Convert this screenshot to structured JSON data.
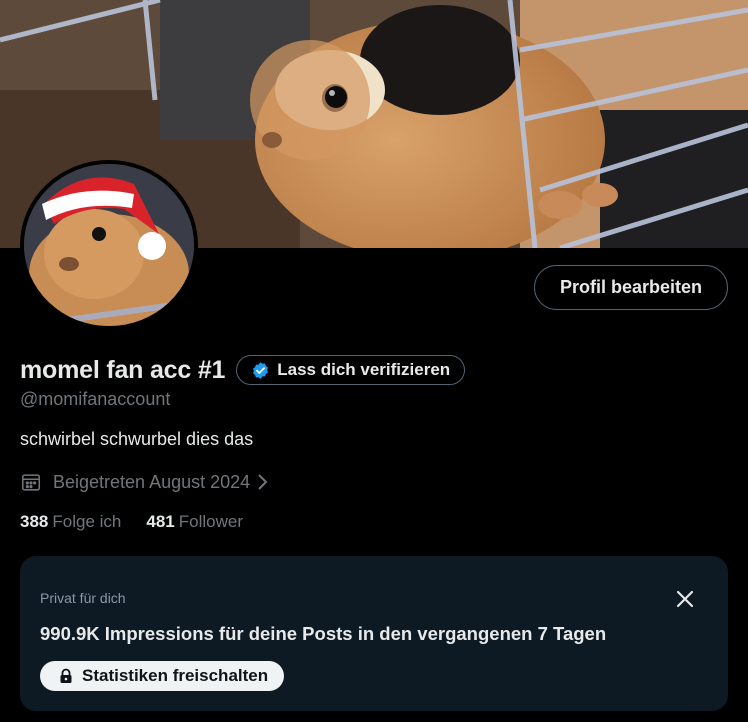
{
  "profile": {
    "display_name": "momel fan acc #1",
    "handle": "@momifanaccount",
    "bio": "schwirbel schwurbel dies das",
    "joined": "Beigetreten August 2024",
    "edit_label": "Profil bearbeiten",
    "verify_label": "Lass dich verifizieren"
  },
  "stats": [
    {
      "count": "388",
      "label": "Folge ich"
    },
    {
      "count": "481",
      "label": "Follower"
    }
  ],
  "promo": {
    "kicker": "Privat für dich",
    "headline": "990.9K Impressions für deine Posts in den vergangenen 7 Tagen",
    "button_label": "Statistiken freischalten"
  },
  "icons": {
    "verify_badge": "verified-badge-icon",
    "calendar": "calendar-icon",
    "chevron": "chevron-right-icon",
    "close": "close-icon",
    "lock": "lock-icon"
  },
  "colors": {
    "background": "#000000",
    "accent_blue": "#1d9bf0",
    "muted_text": "#71767b",
    "card_bg": "#0d1a24"
  }
}
